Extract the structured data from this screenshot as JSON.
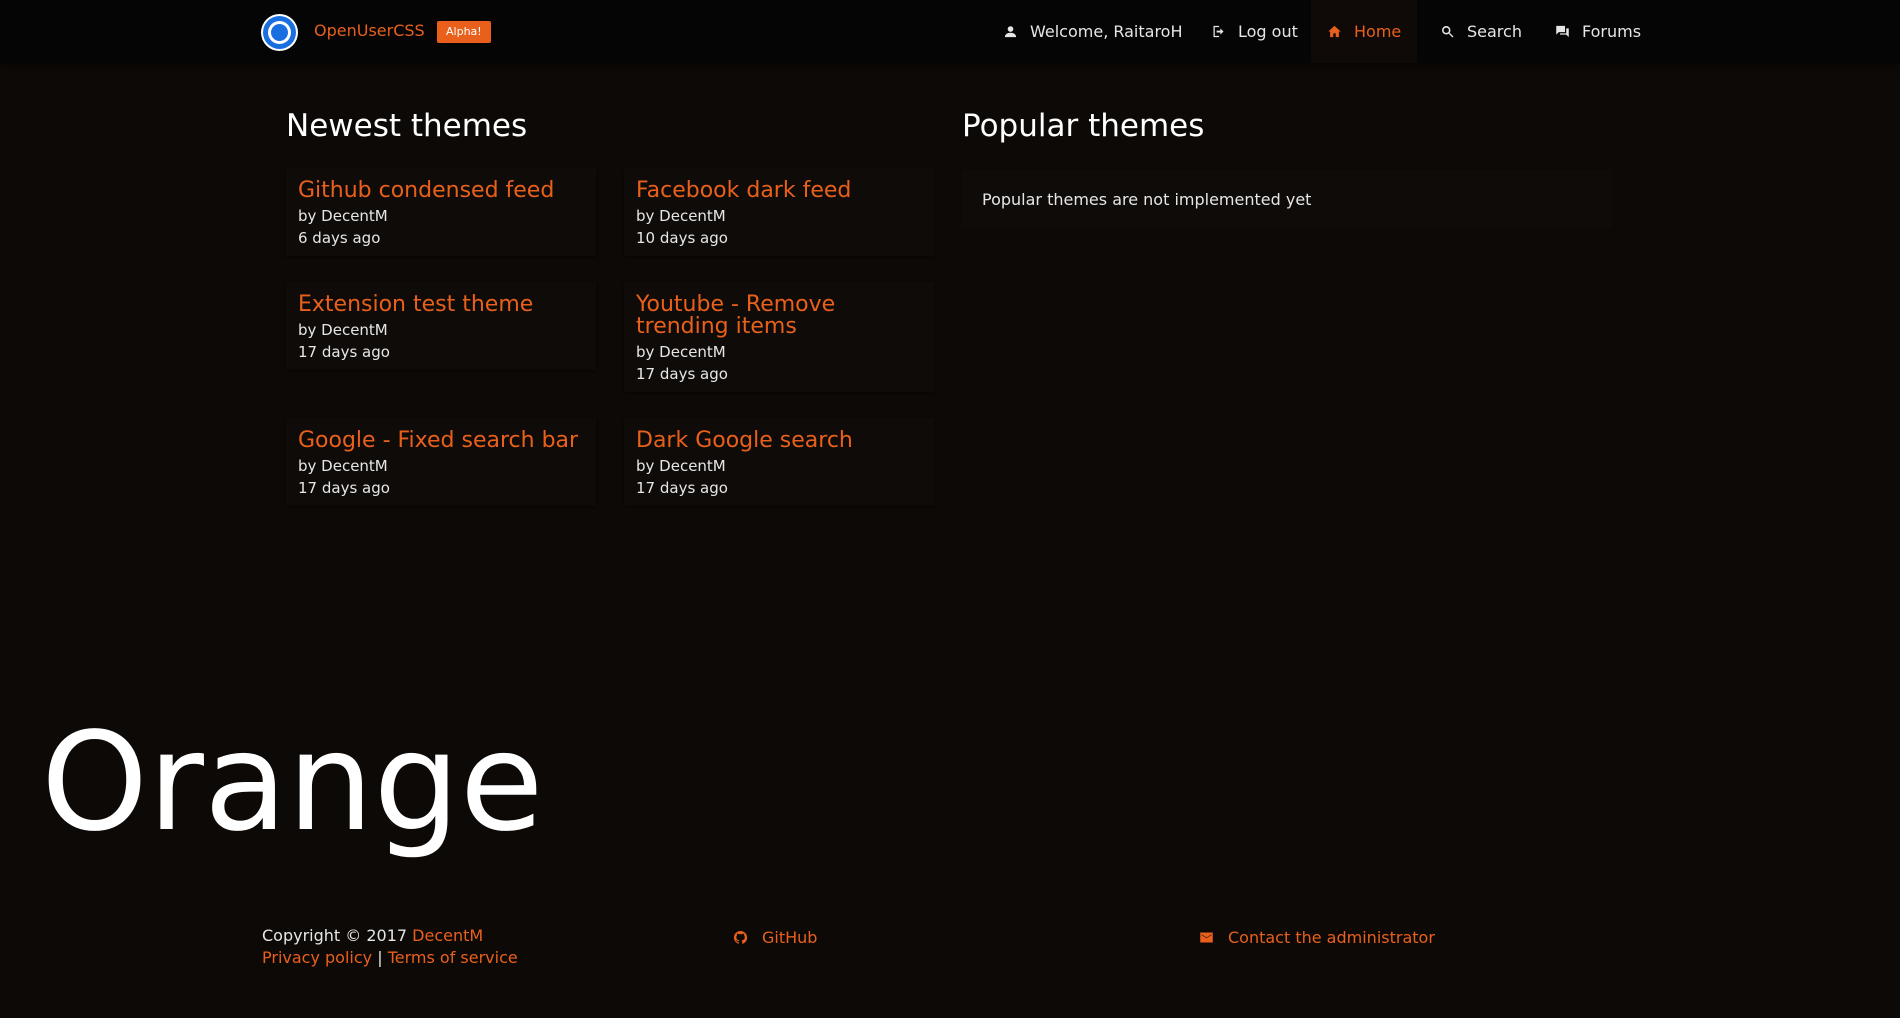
{
  "header": {
    "brand": "OpenUserCSS",
    "badge": "Alpha!",
    "nav": {
      "welcome": "Welcome, RaitaroH",
      "logout": "Log out",
      "home": "Home",
      "search": "Search",
      "forums": "Forums"
    }
  },
  "newest": {
    "title": "Newest themes",
    "themes": [
      {
        "title": "Github condensed feed",
        "author": "by DecentM",
        "age": "6 days ago"
      },
      {
        "title": "Facebook dark feed",
        "author": "by DecentM",
        "age": "10 days ago"
      },
      {
        "title": "Extension test theme",
        "author": "by DecentM",
        "age": "17 days ago"
      },
      {
        "title": "Youtube - Remove trending items",
        "author": "by DecentM",
        "age": "17 days ago"
      },
      {
        "title": "Google - Fixed search bar",
        "author": "by DecentM",
        "age": "17 days ago"
      },
      {
        "title": "Dark Google search",
        "author": "by DecentM",
        "age": "17 days ago"
      }
    ]
  },
  "popular": {
    "title": "Popular themes",
    "message": "Popular themes are not implemented yet"
  },
  "overlay_text": "Orange",
  "footer": {
    "copyright": "Copyright © 2017",
    "copyright_link": "DecentM",
    "privacy": "Privacy policy",
    "separator": "|",
    "terms": "Terms of service",
    "github": "GitHub",
    "contact": "Contact the administrator"
  },
  "colors": {
    "accent": "#e8601c",
    "background": "#0d0907",
    "card": "#0f0b09",
    "logo_blue": "#1a6fe0"
  },
  "icons": [
    "user-icon",
    "logout-icon",
    "home-icon",
    "search-icon",
    "forum-icon",
    "github-icon",
    "mail-icon"
  ]
}
